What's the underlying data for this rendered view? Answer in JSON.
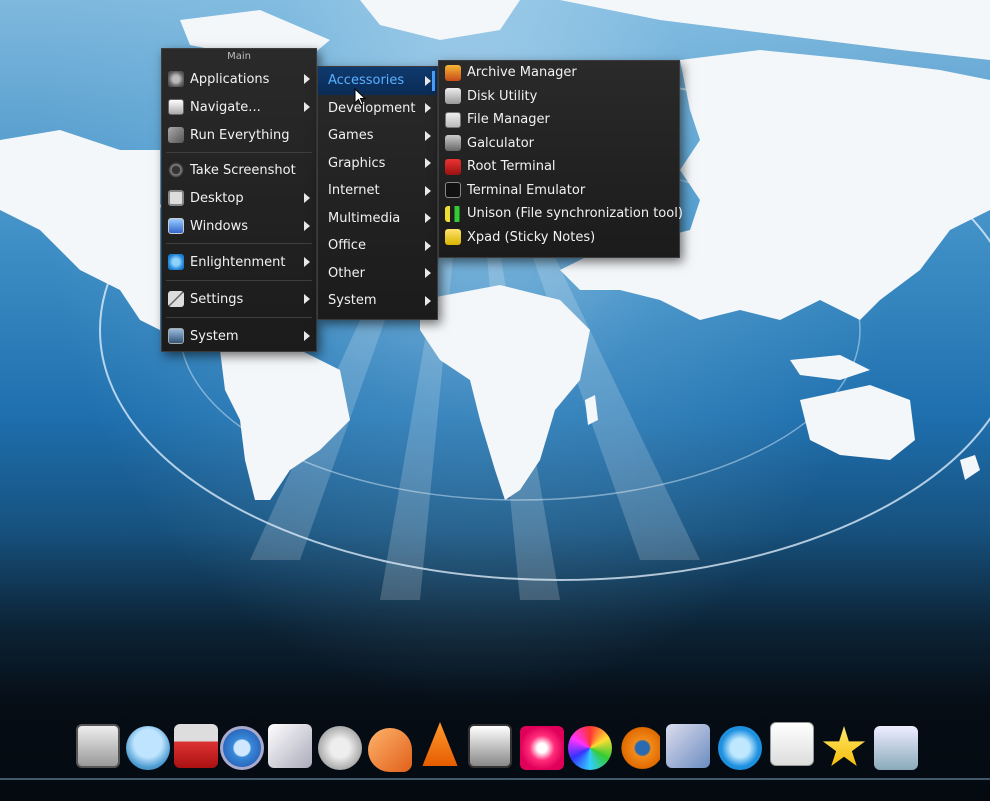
{
  "main_menu": {
    "title": "Main",
    "items": [
      {
        "label": "Applications",
        "icon": "applications-icon",
        "submenu": true
      },
      {
        "label": "Navigate...",
        "icon": "navigate-icon",
        "submenu": true
      },
      {
        "label": "Run Everything",
        "icon": "run-everything-icon",
        "submenu": false
      },
      {
        "label": "Take Screenshot",
        "icon": "camera-icon",
        "submenu": false
      },
      {
        "label": "Desktop",
        "icon": "desktop-icon",
        "submenu": true
      },
      {
        "label": "Windows",
        "icon": "windows-icon",
        "submenu": true
      },
      {
        "label": "Enlightenment",
        "icon": "enlightenment-icon",
        "submenu": true
      },
      {
        "label": "Settings",
        "icon": "settings-tools-icon",
        "submenu": true
      },
      {
        "label": "System",
        "icon": "system-monitor-icon",
        "submenu": true
      }
    ]
  },
  "apps_menu": {
    "items": [
      {
        "label": "Accessories",
        "active": true
      },
      {
        "label": "Development"
      },
      {
        "label": "Games"
      },
      {
        "label": "Graphics"
      },
      {
        "label": "Internet"
      },
      {
        "label": "Multimedia"
      },
      {
        "label": "Office"
      },
      {
        "label": "Other"
      },
      {
        "label": "System"
      }
    ]
  },
  "accessories_menu": {
    "items": [
      {
        "label": "Archive Manager",
        "icon": "archive-manager-icon"
      },
      {
        "label": "Disk Utility",
        "icon": "disk-utility-icon"
      },
      {
        "label": "File Manager",
        "icon": "file-manager-icon"
      },
      {
        "label": "Galculator",
        "icon": "calculator-icon"
      },
      {
        "label": "Root Terminal",
        "icon": "root-terminal-icon"
      },
      {
        "label": "Terminal Emulator",
        "icon": "terminal-icon"
      },
      {
        "label": "Unison (File synchronization tool)",
        "icon": "unison-icon"
      },
      {
        "label": "Xpad (Sticky Notes)",
        "icon": "xpad-icon"
      }
    ]
  },
  "dock": {
    "icons": [
      "computer-icon",
      "chat-icon",
      "network-icon",
      "chromium-icon",
      "image-viewer-icon",
      "music-player-icon",
      "text-editor-icon",
      "vlc-icon",
      "screenshot-icon",
      "flower-app-icon",
      "color-wheel-icon",
      "blender-icon",
      "mail-icon",
      "skype-icon",
      "document-icon",
      "star-icon",
      "downloads-icon"
    ]
  },
  "colors": {
    "menu_bg": "#1f1f1f",
    "highlight": "#0f3a6e",
    "highlight_text": "#5ab0ff",
    "wallpaper_blue": "#1e6fae"
  }
}
